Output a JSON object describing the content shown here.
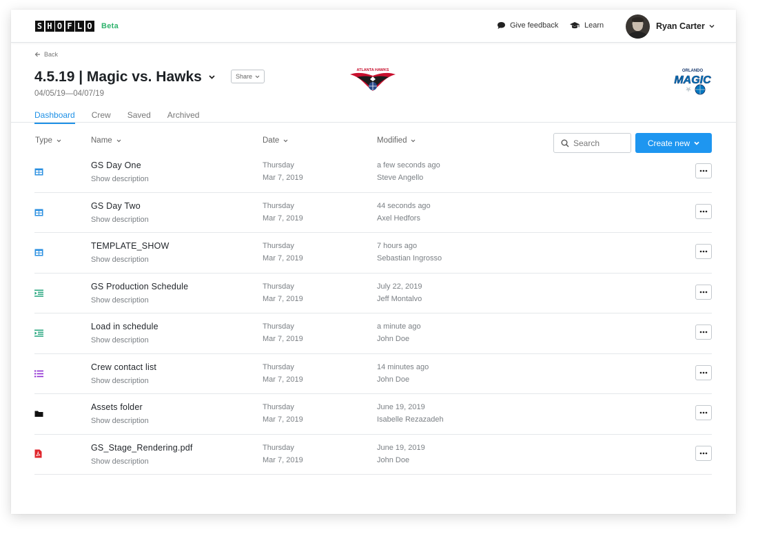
{
  "brand": {
    "logo_letters": [
      "S",
      "H",
      "O",
      "F",
      "L",
      "O"
    ],
    "beta": "Beta",
    "accent": "#1e96f0",
    "beta_color": "#2fb36d"
  },
  "topnav": {
    "feedback": "Give feedback",
    "learn": "Learn",
    "user_name": "Ryan Carter"
  },
  "header": {
    "back": "Back",
    "title": "4.5.19 | Magic vs. Hawks",
    "share": "Share",
    "date_range": "04/05/19—04/07/19",
    "hawks_logo_text": "ATLANTA HAWKS",
    "magic_logo_text": "ORLANDO",
    "magic_logo_wordmark": "MAGIC"
  },
  "tabs": [
    {
      "label": "Dashboard",
      "active": true
    },
    {
      "label": "Crew",
      "active": false
    },
    {
      "label": "Saved",
      "active": false
    },
    {
      "label": "Archived",
      "active": false
    }
  ],
  "columns": {
    "type": "Type",
    "name": "Name",
    "date": "Date",
    "modified": "Modified"
  },
  "search": {
    "placeholder": "Search"
  },
  "create_button": "Create new",
  "rows": [
    {
      "icon": "spreadsheet-icon",
      "name": "GS Day One",
      "desc": "Show description",
      "day": "Thursday",
      "date": "Mar 7, 2019",
      "modified": "a few seconds ago",
      "user": "Steve Angello"
    },
    {
      "icon": "spreadsheet-icon",
      "name": "GS Day Two",
      "desc": "Show description",
      "day": "Thursday",
      "date": "Mar 7, 2019",
      "modified": "44 seconds ago",
      "user": "Axel Hedfors"
    },
    {
      "icon": "spreadsheet-icon",
      "name": "TEMPLATE_SHOW",
      "desc": "Show description",
      "day": "Thursday",
      "date": "Mar 7, 2019",
      "modified": "7 hours ago",
      "user": "Sebastian Ingrosso"
    },
    {
      "icon": "schedule-icon",
      "name": "GS Production Schedule",
      "desc": "Show description",
      "day": "Thursday",
      "date": "Mar 7, 2019",
      "modified": "July 22, 2019",
      "user": "Jeff Montalvo"
    },
    {
      "icon": "schedule-icon",
      "name": "Load in schedule",
      "desc": "Show description",
      "day": "Thursday",
      "date": "Mar 7, 2019",
      "modified": "a minute ago",
      "user": "John Doe"
    },
    {
      "icon": "list-icon",
      "name": "Crew contact list",
      "desc": "Show description",
      "day": "Thursday",
      "date": "Mar 7, 2019",
      "modified": "14 minutes ago",
      "user": "John Doe"
    },
    {
      "icon": "folder-icon",
      "name": "Assets folder",
      "desc": "Show description",
      "day": "Thursday",
      "date": "Mar 7, 2019",
      "modified": "June 19, 2019",
      "user": "Isabelle Rezazadeh"
    },
    {
      "icon": "pdf-icon",
      "name": "GS_Stage_Rendering.pdf",
      "desc": "Show description",
      "day": "Thursday",
      "date": "Mar 7, 2019",
      "modified": "June 19, 2019",
      "user": "John Doe"
    }
  ],
  "icon_colors": {
    "spreadsheet-icon": "#2a8fe0",
    "schedule-icon": "#1fa37a",
    "list-icon": "#8e2bd1",
    "folder-icon": "#111111",
    "pdf-icon": "#e0262c"
  }
}
